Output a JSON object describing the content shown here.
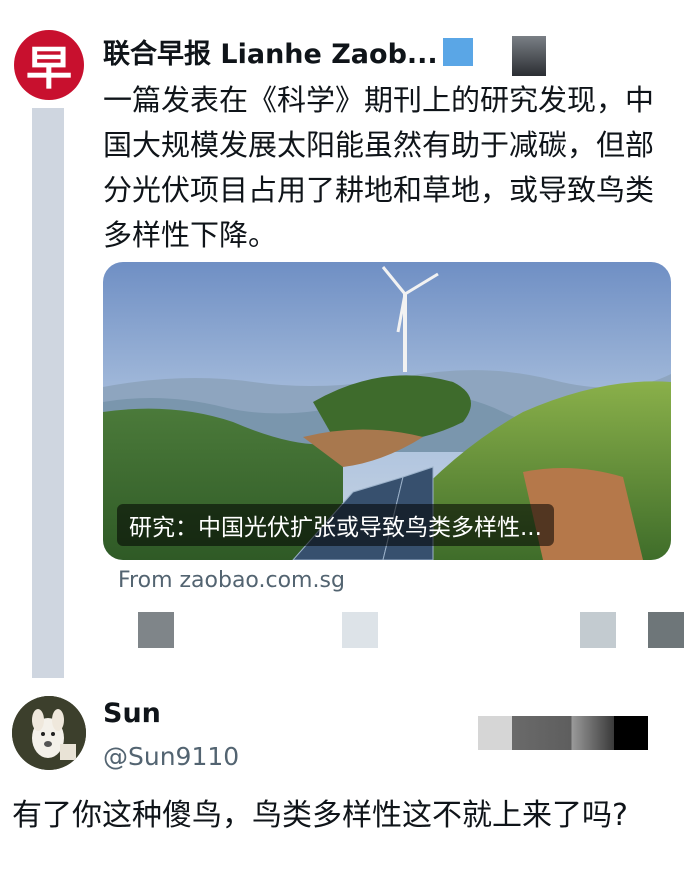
{
  "post": {
    "author": "联合早报 Lianhe Zaob...",
    "avatar_glyph": "早",
    "text": "一篇发表在《科学》期刊上的研究发现，中国大规模发展太阳能虽然有助于减碳，但部分光伏项目占用了耕地和草地，或导致鸟类多样性下降。",
    "card": {
      "caption": "研究：中国光伏扩张或导致鸟类多样性...",
      "source": "From zaobao.com.sg"
    }
  },
  "reply": {
    "name": "Sun",
    "handle": "@Sun9110",
    "text": "有了你这种傻鸟，鸟类多样性这不就上来了吗?"
  },
  "colors": {
    "brand_red": "#c8102e",
    "verified_blue": "#5aa6e6",
    "secondary_text": "#536471"
  },
  "icons": [
    "newspaper-logo-icon",
    "verified-badge-icon",
    "reply-icon",
    "retweet-icon",
    "like-icon",
    "share-icon"
  ]
}
